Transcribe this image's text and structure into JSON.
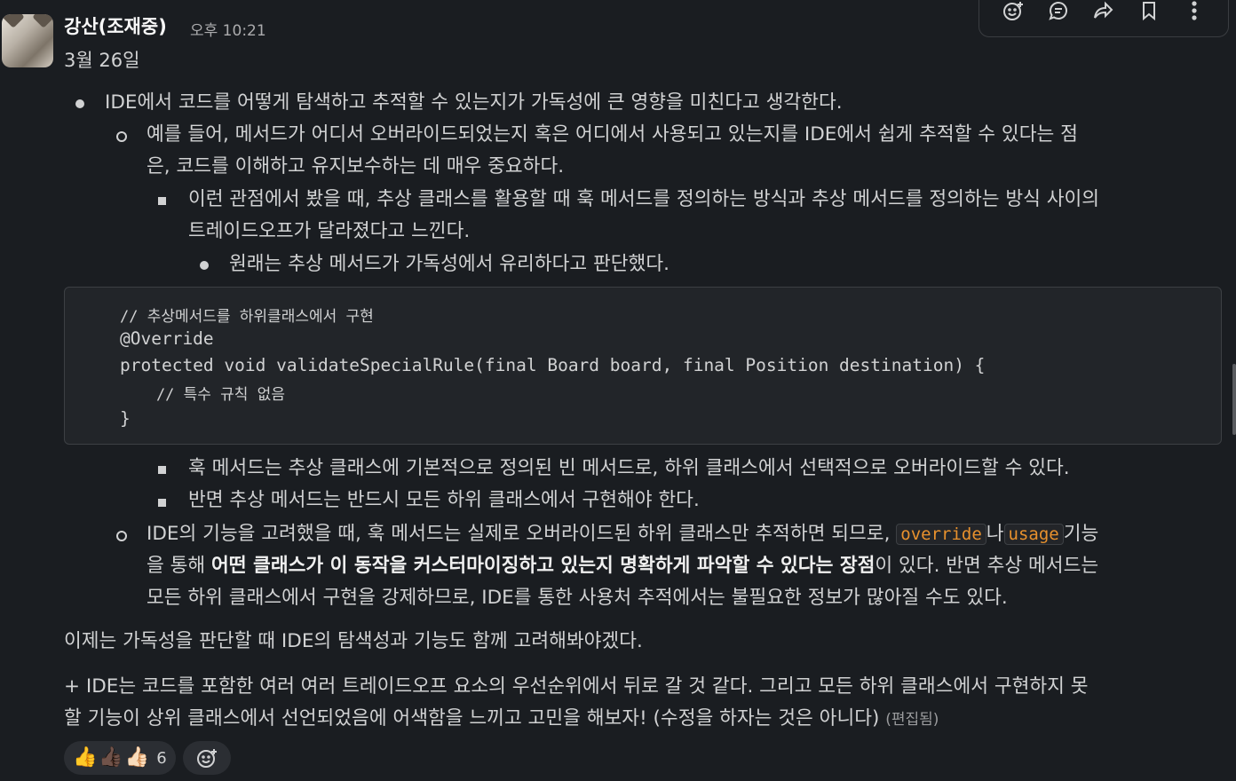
{
  "message": {
    "author": "강산(조재중)",
    "time": "오후 10:21",
    "date_line": "3월 26일",
    "lines": [
      "IDE에서 코드를 어떻게 탐색하고 추적할 수 있는지가 가독성에 큰 영향을 미친다고 생각한다.",
      "예를 들어, 메서드가 어디서 오버라이드되었는지 혹은 어디에서 사용되고 있는지를 IDE에서 쉽게 추적할 수 있다는 점",
      "은, 코드를 이해하고 유지보수하는 데 매우 중요하다.",
      "이런 관점에서 봤을 때, 추상 클래스를 활용할 때 훅 메서드를 정의하는 방식과 추상 메서드를 정의하는 방식 사이의",
      "트레이드오프가 달라졌다고 느낀다.",
      "원래는 추상 메서드가 가독성에서 유리하다고 판단했다."
    ],
    "code_lines": [
      "// 추상메서드를 하위클래스에서 구현",
      "@Override",
      "protected void validateSpecialRule(final Board board, final Position destination) {",
      "    // 특수 규칙 없음",
      "}"
    ],
    "lines_after_code": [
      "훅 메서드는 추상 클래스에 기본적으로 정의된 빈 메서드로, 하위 클래스에서 선택적으로 오버라이드할 수 있다.",
      "반면 추상 메서드는 반드시 모든 하위 클래스에서 구현해야 한다."
    ],
    "ide_para": {
      "line1_a": "IDE의 기능을 고려했을 때, 훅 메서드는 실제로 오버라이드된 하위 클래스만 추적하면 되므로, ",
      "code1": "override",
      "line1_b": "나",
      "code2": "usage",
      "line1_c": "기능",
      "line2_a": "을 통해 ",
      "line2_bold": "어떤 클래스가 이 동작을 커스터마이징하고 있는지 명확하게 파악할 수 있다는 장점",
      "line2_c": "이 있다. 반면 추상 메서드는",
      "line3": "모든 하위 클래스에서 구현을 강제하므로, IDE를 통한 사용처 추적에서는 불필요한 정보가 많아질 수도 있다."
    },
    "conclusion": "이제는 가독성을 판단할 때 IDE의 탐색성과 기능도 함께 고려해봐야겠다.",
    "addendum_line1": "+ IDE는 코드를 포함한 여러 여러 트레이드오프 요소의 우선순위에서 뒤로 갈 것 같다. 그리고 모든 하위 클래스에서 구현하지 못",
    "addendum_line2": "할 기능이 상위 클래스에서 선언되었음에 어색함을 느끼고 고민을 해보자! (수정을 하자는 것은 아니다)",
    "edited_label": "(편집됨)"
  },
  "reactions": {
    "emojis": [
      "👍",
      "👍🏿",
      "👍🏻"
    ],
    "count": "6"
  },
  "toolbar_icons": [
    "add-reaction-icon",
    "reply-thread-icon",
    "share-icon",
    "bookmark-icon",
    "more-actions-icon"
  ],
  "colors": {
    "background": "#1a1d21",
    "text": "#d1d2d3",
    "inline_code": "#e8912d",
    "code_block_bg": "#222529"
  }
}
